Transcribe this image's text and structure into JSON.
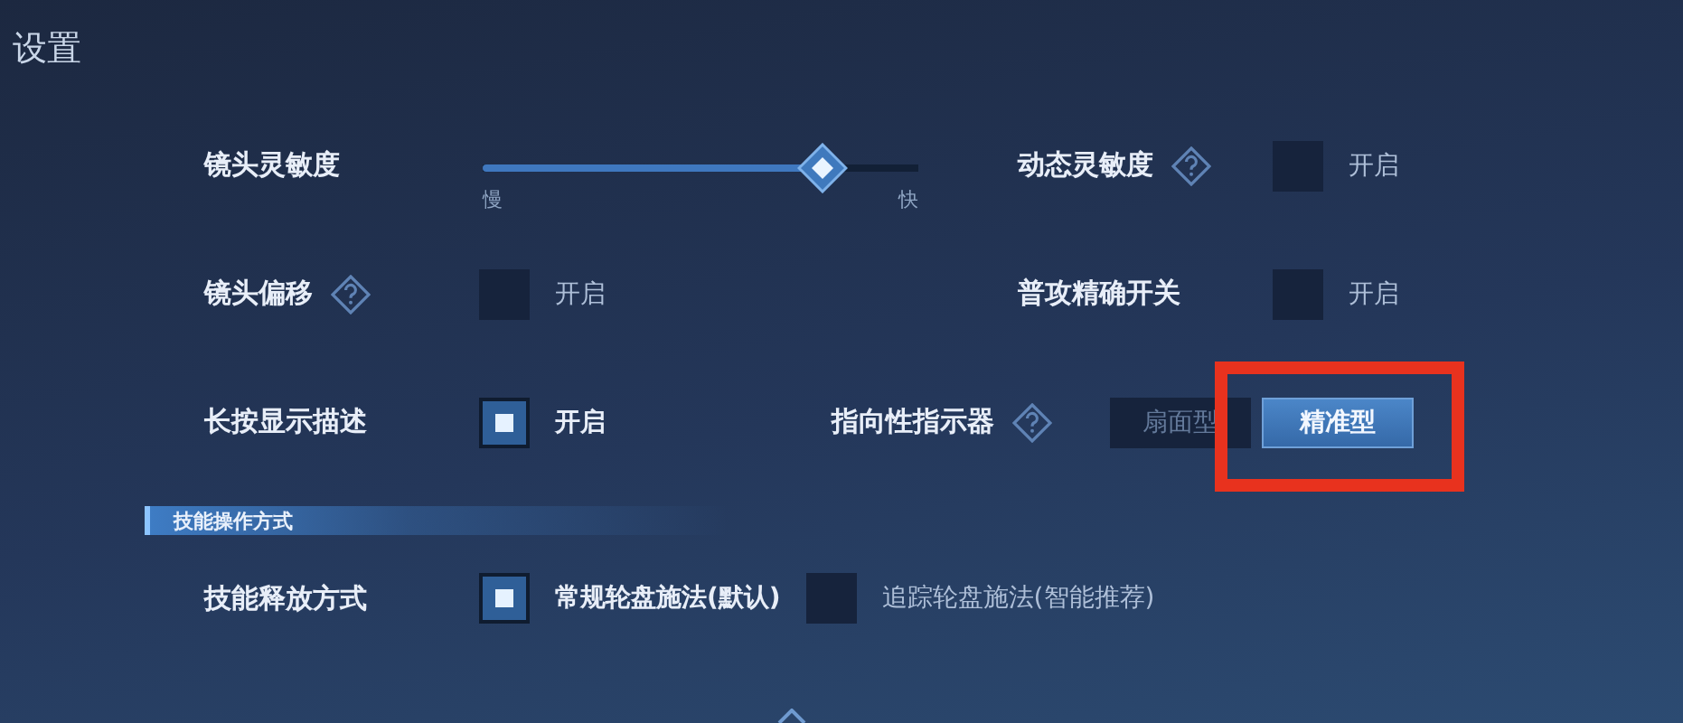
{
  "title": "设置",
  "rows": [
    [
      {
        "kind": "slider",
        "label": "镜头灵敏度",
        "level": 0.78,
        "min_label": "慢",
        "max_label": "快"
      },
      {
        "kind": "toggle",
        "label": "动态灵敏度",
        "help": true,
        "checked": false,
        "option": "开启"
      }
    ],
    [
      {
        "kind": "toggle",
        "label": "镜头偏移",
        "help": true,
        "checked": false,
        "option": "开启"
      },
      {
        "kind": "toggle",
        "label": "普攻精确开关",
        "help": false,
        "checked": false,
        "option": "开启"
      }
    ],
    [
      {
        "kind": "toggle",
        "label": "长按显示描述",
        "help": false,
        "checked": true,
        "option": "开启"
      },
      {
        "kind": "segmented",
        "label": "指向性指示器",
        "help": true,
        "options": [
          {
            "label": "扇面型",
            "selected": false,
            "highlighted": false
          },
          {
            "label": "精准型",
            "selected": true,
            "highlighted": true
          }
        ]
      }
    ]
  ],
  "section": {
    "title": "技能操作方式",
    "settings": [
      {
        "label": "技能释放方式",
        "options": [
          {
            "label": "常规轮盘施法(默认)",
            "checked": true
          },
          {
            "label": "追踪轮盘施法(智能推荐)",
            "checked": false
          }
        ]
      }
    ]
  }
}
